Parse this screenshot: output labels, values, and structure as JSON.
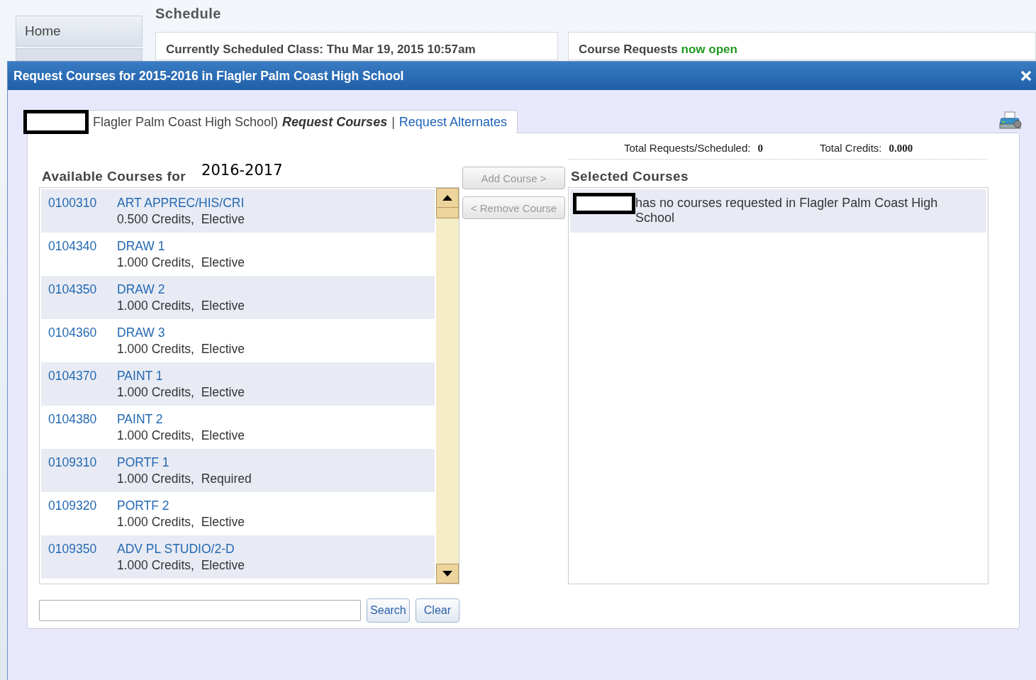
{
  "page": {
    "title": "Schedule",
    "nav": [
      {
        "label": "Home"
      }
    ],
    "scheduled_class": "Currently Scheduled Class: Thu Mar 19, 2015 10:57am",
    "requests": {
      "label": "Course Requests",
      "status": "now open"
    }
  },
  "dialog": {
    "title": "Request Courses for 2015-2016 in Flagler Palm Coast High School",
    "school_note": "Flagler Palm Coast High School)",
    "tabs": [
      {
        "label": "Request Courses",
        "selected": true
      },
      {
        "label": "Request Alternates",
        "selected": false
      }
    ],
    "separator": "|",
    "totals": [
      {
        "label": "Total Requests/Scheduled:",
        "value": "0"
      },
      {
        "label": "Total Credits:",
        "value": "0.000"
      }
    ],
    "available_heading": "Available Courses for",
    "year_overlay": "2016-2017",
    "courses": [
      {
        "code": "0100310",
        "name": "ART APPREC/HIS/CRI",
        "credits": "0.500 Credits,",
        "type": "Elective"
      },
      {
        "code": "0104340",
        "name": "DRAW 1",
        "credits": "1.000 Credits,",
        "type": "Elective"
      },
      {
        "code": "0104350",
        "name": "DRAW 2",
        "credits": "1.000 Credits,",
        "type": "Elective"
      },
      {
        "code": "0104360",
        "name": "DRAW 3",
        "credits": "1.000 Credits,",
        "type": "Elective"
      },
      {
        "code": "0104370",
        "name": "PAINT 1",
        "credits": "1.000 Credits,",
        "type": "Elective"
      },
      {
        "code": "0104380",
        "name": "PAINT 2",
        "credits": "1.000 Credits,",
        "type": "Elective"
      },
      {
        "code": "0109310",
        "name": "PORTF 1",
        "credits": "1.000 Credits,",
        "type": "Required"
      },
      {
        "code": "0109320",
        "name": "PORTF 2",
        "credits": "1.000 Credits,",
        "type": "Elective"
      },
      {
        "code": "0109350",
        "name": "ADV PL STUDIO/2-D",
        "credits": "1.000 Credits,",
        "type": "Elective"
      }
    ],
    "actions": [
      {
        "label": "Add Course >",
        "disabled": true
      },
      {
        "label": "< Remove Course",
        "disabled": true
      }
    ],
    "selected_heading": "Selected Courses",
    "empty_message": "has no courses requested in Flagler Palm Coast High School",
    "search_buttons": [
      "Search",
      "Clear"
    ]
  }
}
